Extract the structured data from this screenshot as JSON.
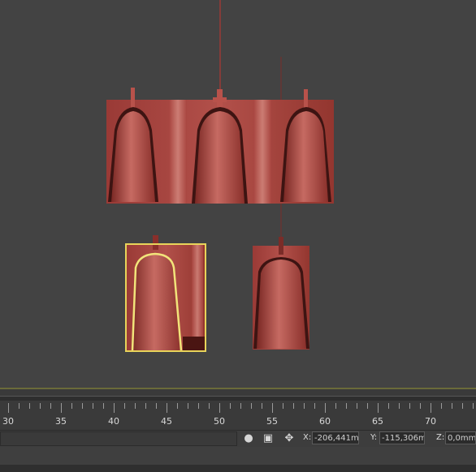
{
  "timeline": {
    "ruler_labels": [
      "30",
      "35",
      "40",
      "45",
      "50",
      "55",
      "60",
      "65",
      "70"
    ]
  },
  "status_bar": {
    "icons": [
      "lightbulb-icon",
      "lock-icon",
      "transform-gizmo-icon"
    ],
    "coords": {
      "x_label": "X:",
      "x_value": "-206,441m",
      "y_label": "Y:",
      "y_value": "-115,306m",
      "z_label": "Z:",
      "z_value": "0,0mm"
    }
  },
  "colors": {
    "viewport_bg": "#434343",
    "lamp_red": "#a3413d",
    "selection_highlight": "#e8d45a"
  }
}
